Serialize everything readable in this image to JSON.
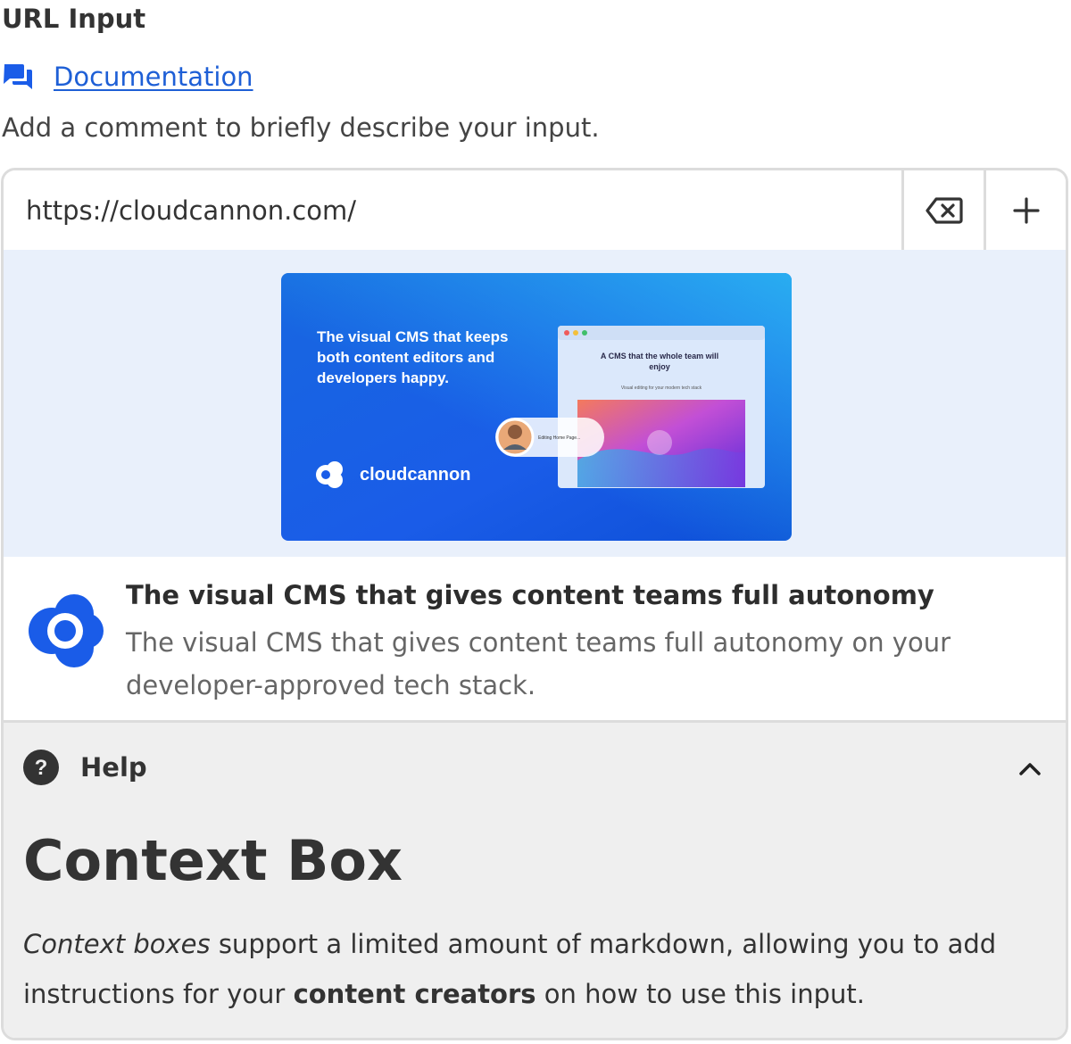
{
  "field": {
    "label": "URL Input",
    "documentation_link": "Documentation",
    "comment": "Add a comment to briefly describe your input."
  },
  "input": {
    "value": "https://cloudcannon.com/",
    "clear_icon": "backspace-icon",
    "add_icon": "plus-icon"
  },
  "preview": {
    "image_headline": "The visual CMS that keeps both content editors and developers happy.",
    "image_headline_lines": [
      "The visual CMS that keeps",
      "both content editors and",
      "developers happy."
    ],
    "image_brand": "cloudcannon",
    "image_window_title_lines": [
      "A CMS that the whole team will",
      "enjoy"
    ],
    "image_window_subtitle": "Visual editing for your modern tech stack",
    "image_editing_badge": "Editing Home Page...",
    "title": "The visual CMS that gives content teams full autonomy",
    "description": "The visual CMS that gives content teams full autonomy on your developer-approved tech stack."
  },
  "help": {
    "label": "Help",
    "icon": "question-circle-icon",
    "toggle_icon": "chevron-up-icon",
    "heading": "Context Box",
    "body_italic": "Context boxes",
    "body_part1": " support a limited amount of markdown, allowing you to add instructions for your ",
    "body_bold": "content creators",
    "body_part2": " on how to use this input."
  },
  "colors": {
    "link": "#1e5fd6",
    "brand_blue": "#1a5ce8",
    "preview_bg": "#e9f0fb",
    "help_bg": "#efefef",
    "border": "#dcdcdc"
  }
}
